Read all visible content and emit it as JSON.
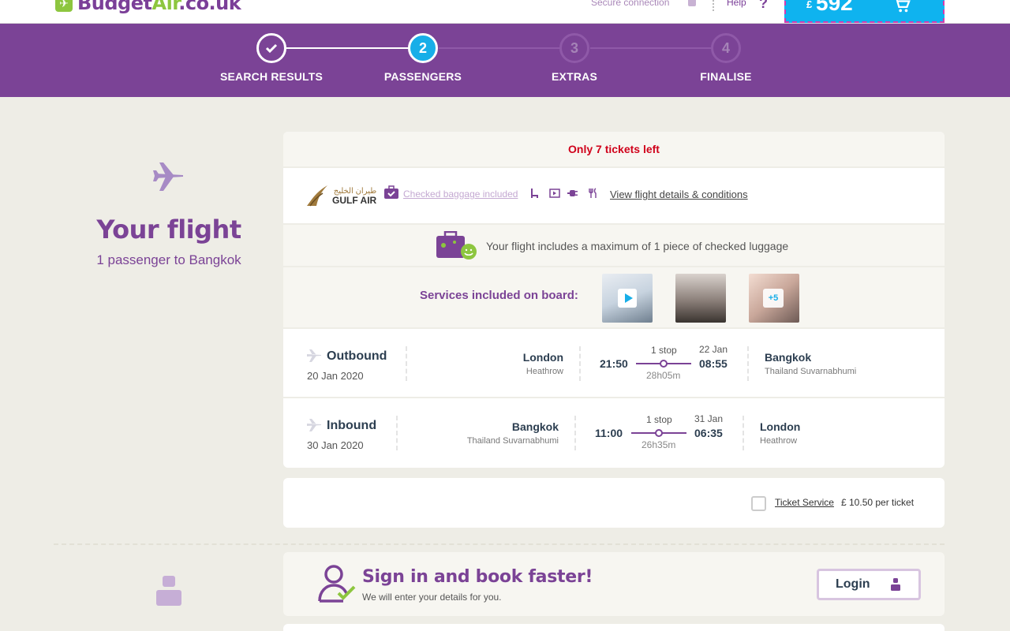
{
  "header": {
    "logo_text_a": "Budget",
    "logo_text_b": "Air",
    "logo_text_c": ".co.uk",
    "secure": "Secure connection",
    "help": "Help",
    "help_icon": "?",
    "currency": "£",
    "price": "592"
  },
  "steps": [
    {
      "label": "SEARCH RESULTS",
      "state": "done",
      "icon": "check-icon"
    },
    {
      "label": "PASSENGERS",
      "num": "2",
      "state": "active"
    },
    {
      "label": "EXTRAS",
      "num": "3",
      "state": "todo"
    },
    {
      "label": "FINALISE",
      "num": "4",
      "state": "todo"
    }
  ],
  "left": {
    "title": "Your flight",
    "subtitle": "1 passenger to Bangkok"
  },
  "flight": {
    "tickets_left": "Only 7 tickets left",
    "airline_name": "GULF AIR",
    "airline_arabic": "طيران الخليج",
    "baggage_link": "Checked baggage included",
    "details_link": "View flight details & conditions",
    "luggage_text": "Your flight includes a maximum of 1 piece of checked luggage",
    "services_label": "Services included on board:",
    "services_more": "+5",
    "legs": [
      {
        "direction": "Outbound",
        "date": "20 Jan 2020",
        "from_city": "London",
        "from_airport": "Heathrow",
        "dep_time": "21:50",
        "stops": "1 stop",
        "duration": "28h05m",
        "arr_date": "22 Jan",
        "arr_time": "08:55",
        "to_city": "Bangkok",
        "to_airport": "Thailand Suvarnabhumi"
      },
      {
        "direction": "Inbound",
        "date": "30 Jan 2020",
        "from_city": "Bangkok",
        "from_airport": "Thailand Suvarnabhumi",
        "dep_time": "11:00",
        "stops": "1 stop",
        "duration": "26h35m",
        "arr_date": "31 Jan",
        "arr_time": "06:35",
        "to_city": "London",
        "to_airport": "Heathrow"
      }
    ],
    "ticket_service_link": "Ticket Service",
    "ticket_service_price": "£ 10.50 per ticket"
  },
  "signin": {
    "title": "Sign in and book faster!",
    "subtitle": "We will enter your details for you.",
    "login_label": "Login"
  },
  "colors": {
    "brand_purple": "#7b4396",
    "brand_green": "#8dc63f",
    "accent_blue": "#17aee8",
    "alert_red": "#d0021b"
  }
}
